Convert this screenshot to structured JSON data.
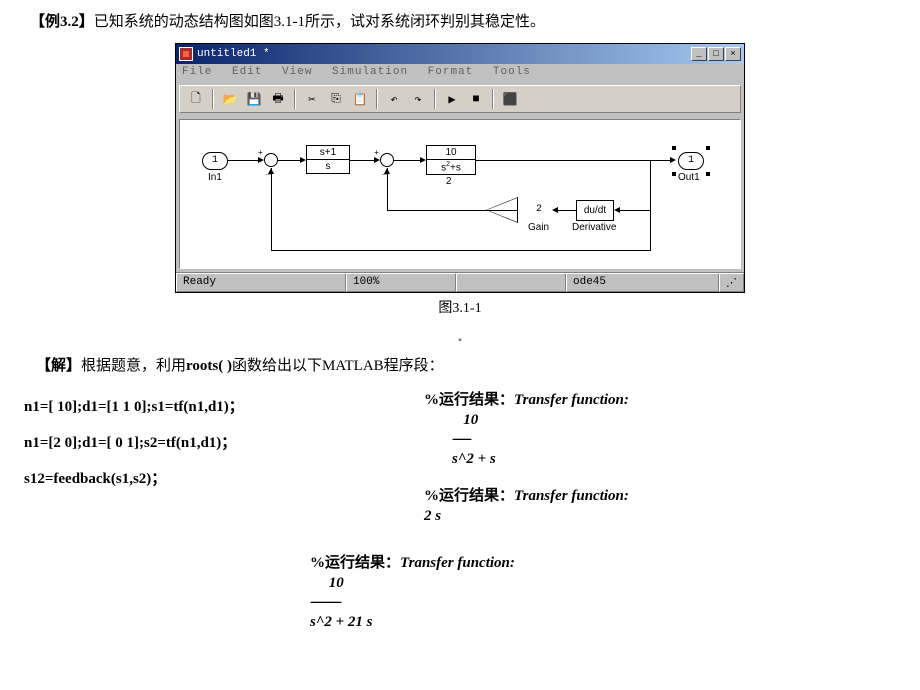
{
  "example": {
    "label": "【例3.2】",
    "text": "已知系统的动态结构图如图3.1-1所示，试对系统闭环判别其稳定性。"
  },
  "simulink": {
    "title": "untitled1 *",
    "menu": [
      "File",
      "Edit",
      "View",
      "Simulation",
      "Format",
      "Tools"
    ],
    "window_buttons": {
      "min": "_",
      "max": "□",
      "close": "×"
    },
    "toolbar_icons": [
      "new",
      "open",
      "save",
      "print",
      "cut",
      "copy",
      "paste",
      "undo",
      "redo",
      "play",
      "stop",
      "build"
    ],
    "status": {
      "ready": "Ready",
      "zoom": "100%",
      "blank": "",
      "solver": "ode45"
    },
    "blocks": {
      "in1": {
        "num": "1",
        "label": "In1"
      },
      "tf1": {
        "num": "s+1",
        "den": "s"
      },
      "tf2": {
        "num": "10",
        "den": "s  +s",
        "sup": "2",
        "under": "2"
      },
      "gain": {
        "value": "2",
        "label": "Gain"
      },
      "deriv": {
        "text": "du/dt",
        "label": "Derivative"
      },
      "out1": {
        "num": "1",
        "label": "Out1"
      }
    }
  },
  "fig_caption": "图3.1-1",
  "solution": {
    "label": "【解】",
    "text": "根据题意，利用",
    "func": "roots(  )",
    "text2": "函数给出以下MATLAB程序段："
  },
  "code": {
    "line1": "n1=[ 10];d1=[1 1 0];s1=tf(n1,d1)；",
    "line2": "n1=[2 0];d1=[ 0 1];s2=tf(n1,d1)；",
    "line3": "s12=feedback(s1,s2)；"
  },
  "results": {
    "header_zh": "%运行结果：",
    "header_en": "Transfer function:",
    "r1": {
      "num": "10",
      "dash": "------",
      "den": "s^2 + s"
    },
    "r2": {
      "num": "2 s"
    },
    "r3": {
      "num": "10",
      "dash": "----------",
      "den": "s^2 + 21 s"
    }
  }
}
